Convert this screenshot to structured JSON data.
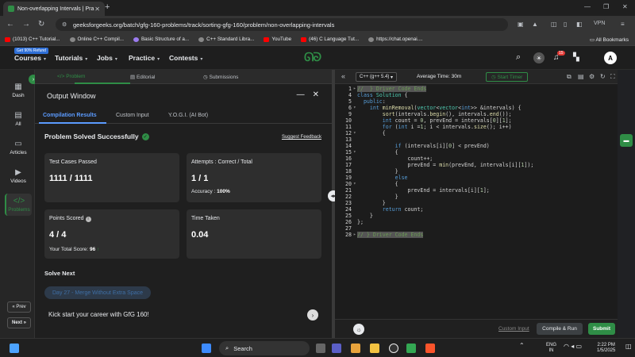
{
  "browser": {
    "tab_title": "Non-overlapping Intervals | Pra",
    "url": "geeksforgeeks.org/batch/gfg-160-problems/track/sorting-gfg-160/problem/non-overlapping-intervals",
    "vpn_label": "VPN",
    "bookmarks": [
      {
        "label": "(1013) C++ Tutorial...",
        "color": "#ff0000"
      },
      {
        "label": "Online C++ Compil...",
        "color": "#888888"
      },
      {
        "label": "Basic Structure of a...",
        "color": "#9c7cf0"
      },
      {
        "label": "C++ Standard Libra...",
        "color": "#888888"
      },
      {
        "label": "YouTube",
        "color": "#ff0000"
      },
      {
        "label": "(46) C Language Tut...",
        "color": "#ff0000"
      },
      {
        "label": "https://chat.openai....",
        "color": "#888888"
      }
    ],
    "all_bookmarks": "All Bookmarks"
  },
  "gfg_header": {
    "offer_badge": "Get 90% Refund",
    "nav": [
      "Courses",
      "Tutorials",
      "Jobs",
      "Practice",
      "Contests"
    ],
    "logo": "GfG",
    "notif_count": "15",
    "avatar_letter": "A"
  },
  "sidebar": {
    "items": [
      {
        "label": "Dash",
        "icon": "▦"
      },
      {
        "label": "All",
        "icon": "▤"
      },
      {
        "label": "Articles",
        "icon": "▭"
      },
      {
        "label": "Videos",
        "icon": "▶"
      },
      {
        "label": "Problems",
        "icon": "</>"
      }
    ],
    "prev": "« Prev",
    "next": "Next »"
  },
  "left_tabs": {
    "problem": "</> Problem",
    "editorial": "Editorial",
    "submissions": "Submissions"
  },
  "output": {
    "title": "Output Window",
    "tabs": [
      "Compilation Results",
      "Custom Input",
      "Y.O.G.I. (AI Bot)"
    ],
    "status": "Problem Solved Successfully",
    "feedback": "Suggest Feedback",
    "cards": {
      "tests_label": "Test Cases Passed",
      "tests_value": "1111 / 1111",
      "attempts_label": "Attempts : Correct / Total",
      "attempts_value": "1 / 1",
      "accuracy_label": "Accuracy :",
      "accuracy_value": "100%",
      "points_label": "Points Scored",
      "points_value": "4 / 4",
      "total_label": "Your Total Score:",
      "total_value": "96",
      "time_label": "Time Taken",
      "time_value": "0.04"
    },
    "solve_next": "Solve Next",
    "next_problem": "Day 27 - Merge Without Extra Space",
    "kick": "Kick start your career with GfG 160!"
  },
  "editor": {
    "language": "C++ (g++ 5.4)",
    "avg_time": "Average Time: 30m",
    "start_timer": "Start Timer",
    "lines": [
      {
        "n": "1",
        "fold": "▸",
        "html": "<span class='cm'>//  } Driver Code Ends</span>"
      },
      {
        "n": "4",
        "fold": "",
        "html": "<span class='kw'>class</span> <span class='ty'>Solution</span> {"
      },
      {
        "n": "5",
        "fold": "",
        "html": "  <span class='kw'>public</span>:"
      },
      {
        "n": "6",
        "fold": "▾",
        "html": "    <span class='kw'>int</span> <span class='fn'>minRemoval</span>(<span class='ty'>vector</span>&lt;<span class='ty'>vector</span>&lt;<span class='kw'>int</span>&gt;&gt; &amp;intervals) {"
      },
      {
        "n": "9",
        "fold": "",
        "html": "        <span class='fn'>sort</span>(intervals.<span class='fn'>begin</span>(), intervals.<span class='fn'>end</span>());"
      },
      {
        "n": "10",
        "fold": "",
        "html": "        <span class='kw'>int</span> count = <span class='nm'>0</span>, prevEnd = intervals[<span class='nm'>0</span>][<span class='nm'>1</span>];"
      },
      {
        "n": "11",
        "fold": "",
        "html": "        <span class='kw'>for</span> (<span class='kw'>int</span> i =<span class='nm'>1</span>; i &lt; intervals.<span class='fn'>size</span>(); i++)"
      },
      {
        "n": "12",
        "fold": "▾",
        "html": "        {"
      },
      {
        "n": "13",
        "fold": "",
        "html": ""
      },
      {
        "n": "14",
        "fold": "",
        "html": "            <span class='kw'>if</span> (intervals[i][<span class='nm'>0</span>] &lt; prevEnd)"
      },
      {
        "n": "15",
        "fold": "▾",
        "html": "            {"
      },
      {
        "n": "16",
        "fold": "",
        "html": "                count++;"
      },
      {
        "n": "17",
        "fold": "",
        "html": "                prevEnd = <span class='fn'>min</span>(prevEnd, intervals[i][<span class='nm'>1</span>]);"
      },
      {
        "n": "18",
        "fold": "",
        "html": "            }"
      },
      {
        "n": "19",
        "fold": "",
        "html": "            <span class='kw'>else</span>"
      },
      {
        "n": "20",
        "fold": "▾",
        "html": "            {"
      },
      {
        "n": "21",
        "fold": "",
        "html": "                prevEnd = intervals[i][<span class='nm'>1</span>];"
      },
      {
        "n": "22",
        "fold": "",
        "html": "            }"
      },
      {
        "n": "23",
        "fold": "",
        "html": "        }"
      },
      {
        "n": "24",
        "fold": "",
        "html": "        <span class='kw'>return</span> count;"
      },
      {
        "n": "25",
        "fold": "",
        "html": "    }"
      },
      {
        "n": "26",
        "fold": "",
        "html": "};"
      },
      {
        "n": "27",
        "fold": "",
        "html": ""
      },
      {
        "n": "28",
        "fold": "▸",
        "html": "<span class='cm'>// } Driver Code Ends</span>"
      }
    ],
    "custom_input": "Custom Input",
    "compile_run": "Compile & Run",
    "submit": "Submit"
  },
  "taskbar": {
    "search": "Search",
    "lang": "ENG",
    "region": "IN",
    "time": "2:22 PM",
    "date": "1/5/2025"
  }
}
